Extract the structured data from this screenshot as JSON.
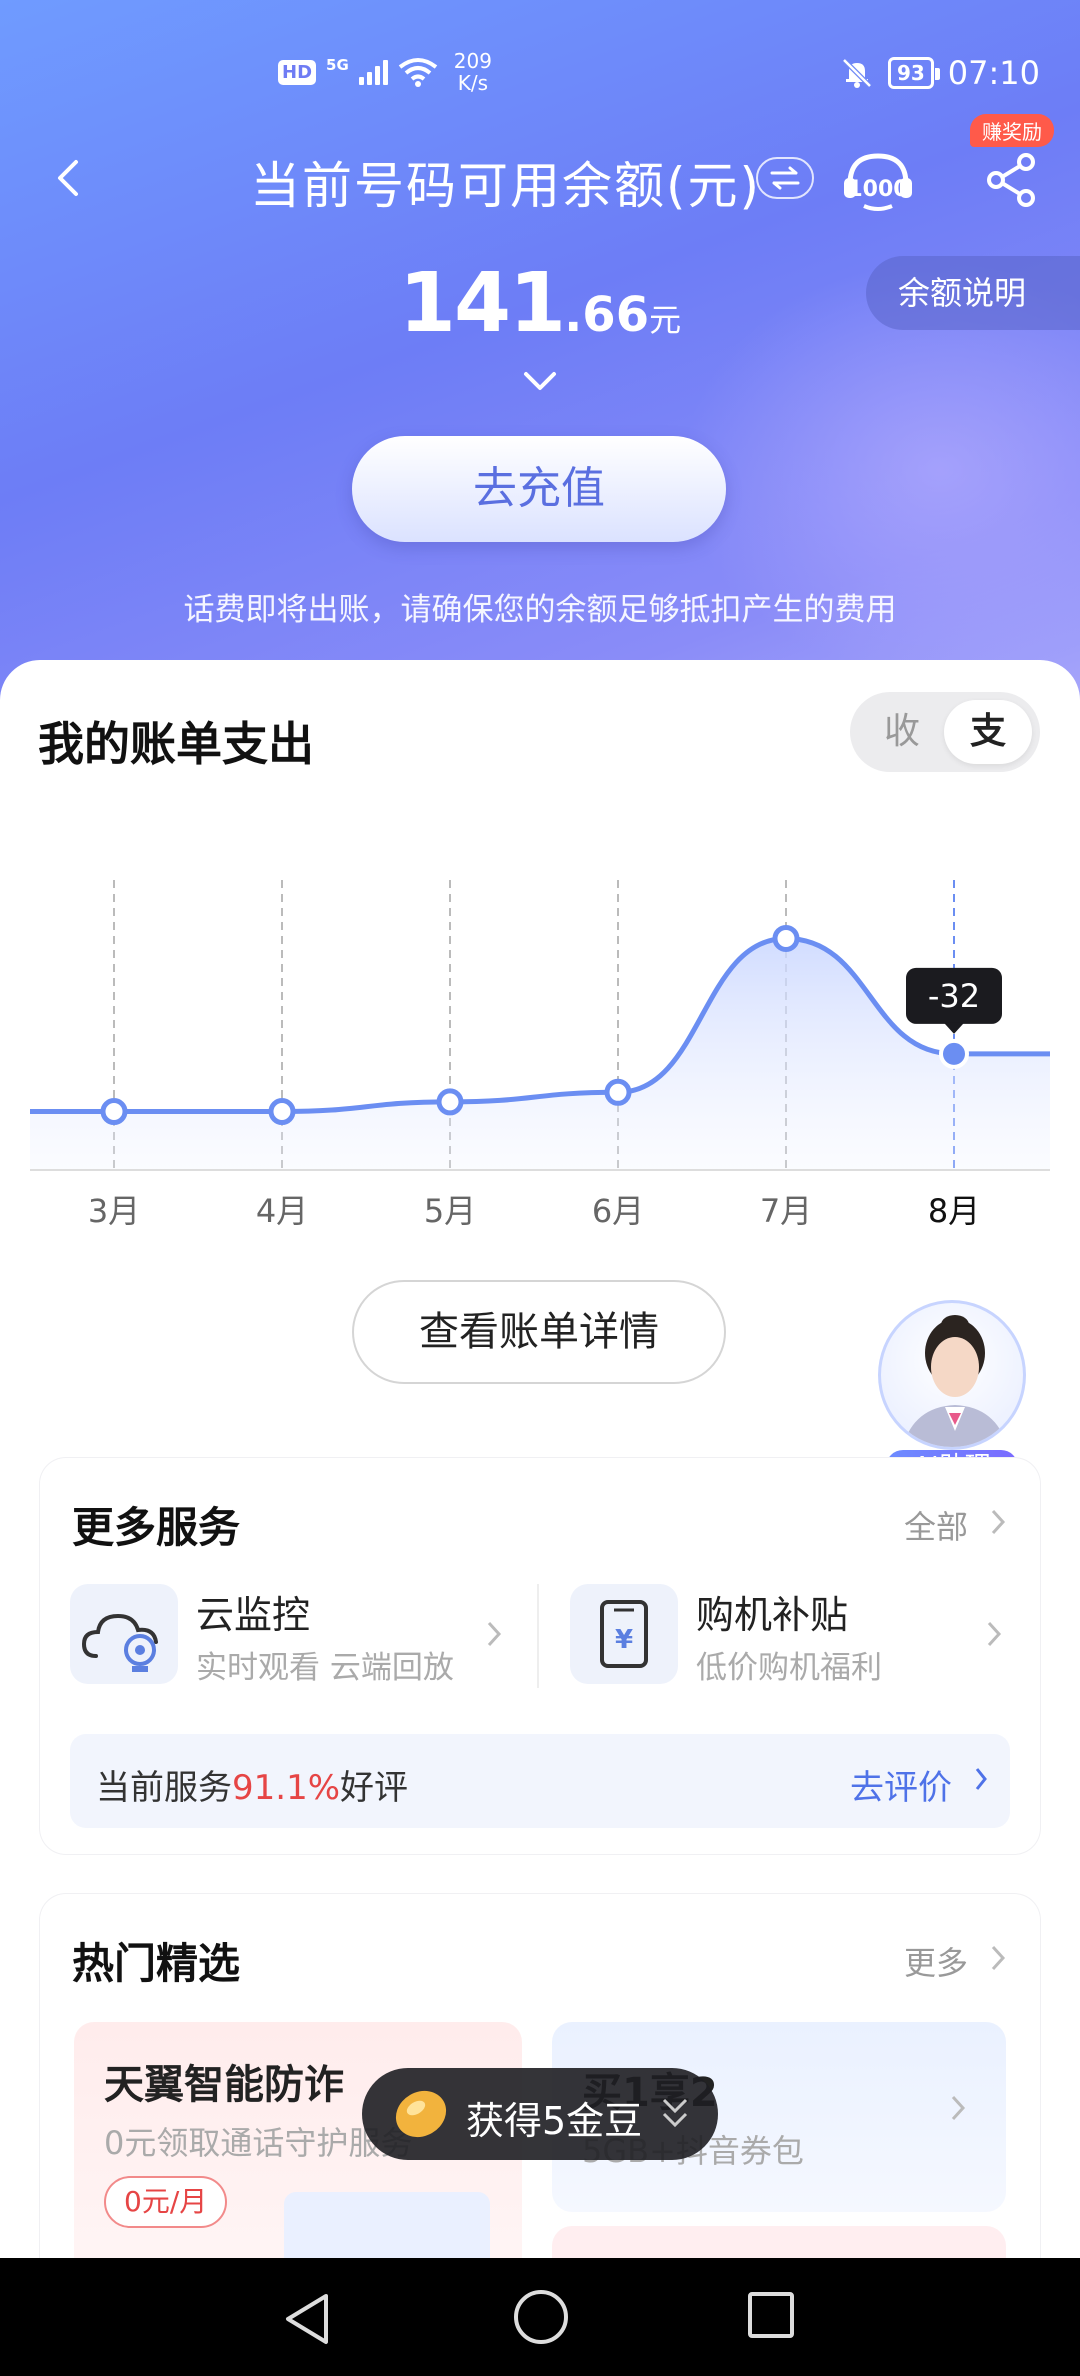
{
  "status_bar": {
    "hd": "HD",
    "signal": "5G",
    "net_speed_value": "209",
    "net_speed_unit": "K/s",
    "battery": "93",
    "time": "07:10"
  },
  "header": {
    "title": "当前号码可用余额(元)",
    "reward_badge": "赚奖励",
    "balance_note": "余额说明"
  },
  "balance": {
    "integer": "141",
    "decimal": ".66",
    "unit": "元"
  },
  "recharge_label": "去充值",
  "tip": "话费即将出账，请确保您的余额足够抵扣产生的费用",
  "bill": {
    "title": "我的账单支出",
    "toggle_in": "收",
    "toggle_out": "支",
    "detail_button": "查看账单详情"
  },
  "chart_data": {
    "type": "area",
    "categories": [
      "3月",
      "4月",
      "5月",
      "6月",
      "7月",
      "8月"
    ],
    "values": [
      -35,
      -35,
      -34.5,
      -34,
      -26,
      -32
    ],
    "highlighted_index": 5,
    "highlight_label": "-32",
    "xlabel": "",
    "ylabel": "",
    "grid": "vertical dashed",
    "accent_color": "#6b8ef2"
  },
  "ai_assistant_label": "AI助理",
  "services": {
    "title": "更多服务",
    "all_label": "全部",
    "items": [
      {
        "name": "云监控",
        "desc": "实时观看 云端回放",
        "icon": "cloud-camera-icon"
      },
      {
        "name": "购机补贴",
        "desc": "低价购机福利",
        "icon": "yuan-phone-icon"
      }
    ],
    "rating_prefix": "当前服务",
    "rating_pct": "91.1%",
    "rating_suffix": "好评",
    "rate_link": "去评价"
  },
  "hot": {
    "title": "热门精选",
    "more_label": "更多",
    "left": {
      "title": "天翼智能防诈",
      "sub": "0元领取通话守护服务",
      "price": "0元/月"
    },
    "right": {
      "title": "买1享2",
      "sub": "5GB+抖音券包"
    }
  },
  "toast": {
    "text": "获得5金豆"
  },
  "colors": {
    "accent": "#6b8ef2",
    "red": "#e64545",
    "link_blue": "#4f72e8"
  }
}
